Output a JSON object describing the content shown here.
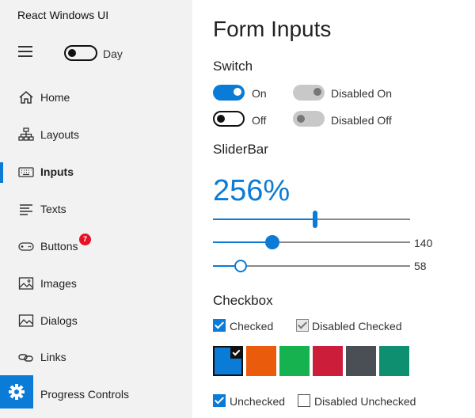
{
  "sidebar": {
    "app_title": "React Windows UI",
    "day_label": "Day",
    "items": [
      {
        "label": "Home",
        "icon": "home-icon"
      },
      {
        "label": "Layouts",
        "icon": "sitemap-icon"
      },
      {
        "label": "Inputs",
        "icon": "keyboard-icon",
        "active": true
      },
      {
        "label": "Texts",
        "icon": "text-lines-icon"
      },
      {
        "label": "Buttons",
        "icon": "gamepad-icon",
        "badge": "7"
      },
      {
        "label": "Images",
        "icon": "image-icon"
      },
      {
        "label": "Dialogs",
        "icon": "dialog-image-icon"
      },
      {
        "label": "Links",
        "icon": "link-icon"
      },
      {
        "label": "Progress Controls",
        "icon": "gear-icon"
      }
    ]
  },
  "main": {
    "title": "Form Inputs",
    "switch_section": "Switch",
    "switches": {
      "on_label": "On",
      "off_label": "Off",
      "disabled_on_label": "Disabled On",
      "disabled_off_label": "Disabled Off"
    },
    "slider_section": "SliderBar",
    "slider_big_value": "256%",
    "sliders": [
      {
        "value_fraction": 0.52
      },
      {
        "value": "140",
        "value_fraction": 0.3
      },
      {
        "value": "58",
        "value_fraction": 0.14
      }
    ],
    "checkbox_section": "Checkbox",
    "checkboxes": {
      "checked_label": "Checked",
      "disabled_checked_label": "Disabled Checked",
      "unchecked_label": "Unchecked",
      "disabled_unchecked_label": "Disabled Unchecked"
    },
    "swatches": [
      {
        "color": "#0a7bd6",
        "selected": true
      },
      {
        "color": "#ea5b0c"
      },
      {
        "color": "#16b24f"
      },
      {
        "color": "#cc1e3a"
      },
      {
        "color": "#4a4f55"
      },
      {
        "color": "#0e8f70"
      }
    ]
  },
  "colors": {
    "accent": "#0a7bd6",
    "badge": "#e81123",
    "sidebar_bg": "#f2f2f2"
  }
}
